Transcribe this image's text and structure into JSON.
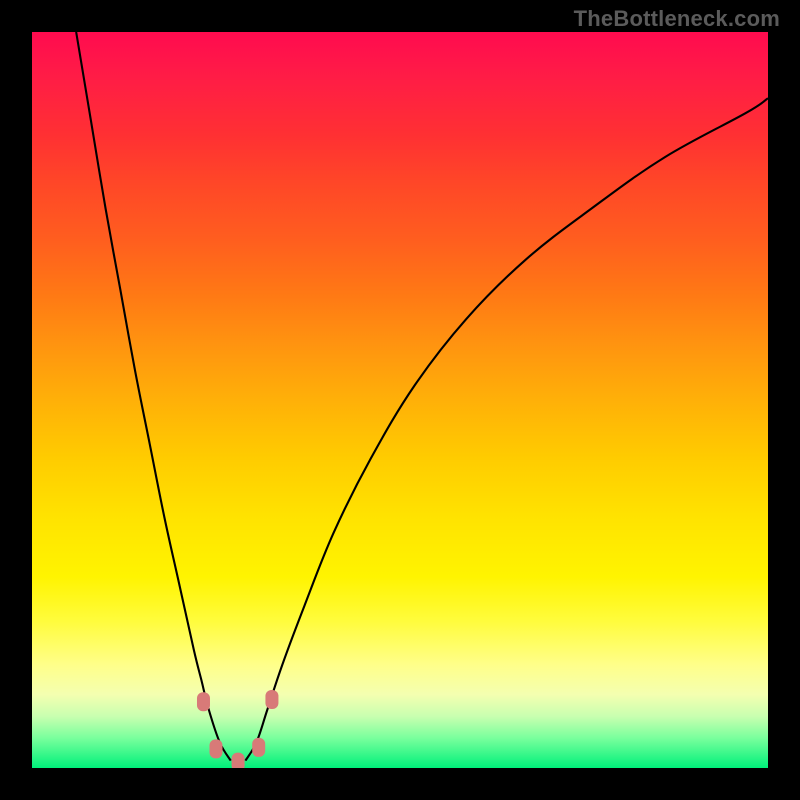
{
  "watermark": "TheBottleneck.com",
  "chart_data": {
    "type": "line",
    "title": "",
    "xlabel": "",
    "ylabel": "",
    "xlim": [
      0,
      100
    ],
    "ylim": [
      0,
      100
    ],
    "grid": false,
    "legend": false,
    "series": [
      {
        "name": "bottleneck-curve-left",
        "x": [
          6,
          8,
          10,
          12,
          14,
          16,
          18,
          20,
          22,
          23,
          24,
          25.5,
          27
        ],
        "y": [
          100,
          88,
          76,
          65,
          54,
          44,
          34,
          25,
          16,
          12,
          8,
          3.5,
          1
        ]
      },
      {
        "name": "bottleneck-curve-right",
        "x": [
          29,
          30.5,
          32,
          34,
          37,
          41,
          46,
          52,
          59,
          67,
          76,
          86,
          97,
          100
        ],
        "y": [
          1,
          3.5,
          8,
          14,
          22,
          32,
          42,
          52,
          61,
          69,
          76,
          83,
          89,
          91
        ]
      }
    ],
    "markers": [
      {
        "x": 23.3,
        "y": 9.0
      },
      {
        "x": 25.0,
        "y": 2.6
      },
      {
        "x": 28.0,
        "y": 0.8
      },
      {
        "x": 30.8,
        "y": 2.8
      },
      {
        "x": 32.6,
        "y": 9.3
      }
    ],
    "marker_style": {
      "shape": "rounded-rect",
      "color": "#d87a78",
      "rx": 6,
      "w": 13,
      "h": 19
    },
    "gradient_stops": [
      {
        "pct": 0,
        "color": "#ff0b4f"
      },
      {
        "pct": 14,
        "color": "#ff3033"
      },
      {
        "pct": 28,
        "color": "#ff5d1f"
      },
      {
        "pct": 42,
        "color": "#ff9210"
      },
      {
        "pct": 58,
        "color": "#ffcc00"
      },
      {
        "pct": 74,
        "color": "#fff400"
      },
      {
        "pct": 90,
        "color": "#f4ffb0"
      },
      {
        "pct": 100,
        "color": "#00f07a"
      }
    ]
  }
}
